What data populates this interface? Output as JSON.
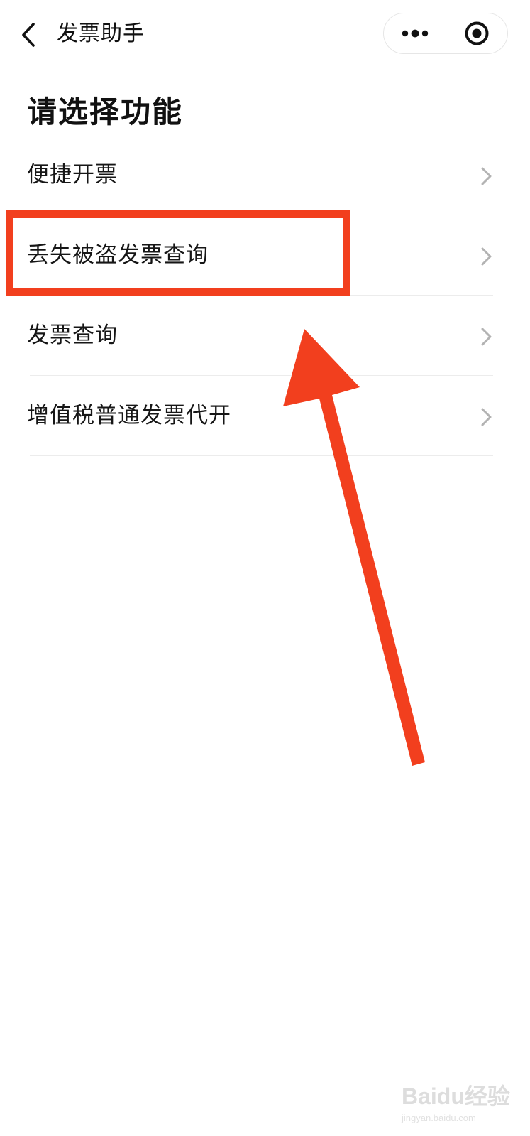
{
  "navbar": {
    "title": "发票助手",
    "back_icon": "chevron-left-icon",
    "more_icon": "more-dots-icon",
    "close_icon": "target-circle-icon"
  },
  "heading": "请选择功能",
  "menu": {
    "items": [
      {
        "label": "便捷开票"
      },
      {
        "label": "丢失被盗发票查询"
      },
      {
        "label": "发票查询"
      },
      {
        "label": "增值税普通发票代开"
      }
    ],
    "chevron_icon": "chevron-right-icon"
  },
  "annotation": {
    "color": "#f23f1e",
    "highlighted_item": "丢失被盗发票查询"
  },
  "watermark": {
    "brand": "Baidu经验",
    "url": "jingyan.baidu.com"
  }
}
